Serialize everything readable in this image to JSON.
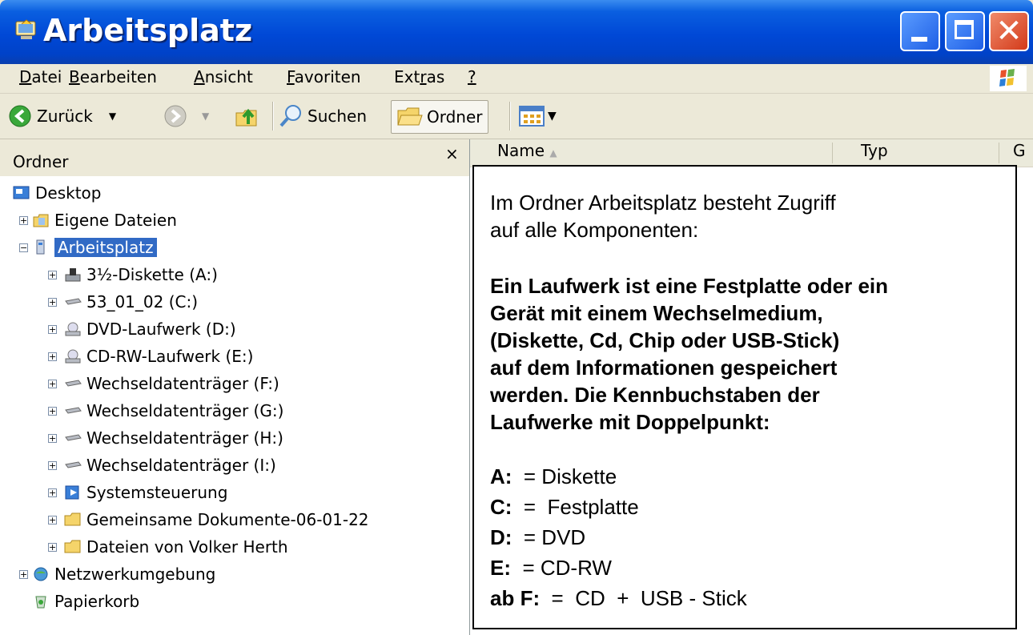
{
  "window": {
    "title": "Arbeitsplatz"
  },
  "menu": [
    {
      "pre": "",
      "ul": "D",
      "post": "atei"
    },
    {
      "pre": "",
      "ul": "B",
      "post": "earbeiten"
    },
    {
      "pre": "",
      "ul": "A",
      "post": "nsicht"
    },
    {
      "pre": "",
      "ul": "F",
      "post": "avoriten"
    },
    {
      "pre": "Ext",
      "ul": "r",
      "post": "as"
    },
    {
      "pre": "",
      "ul": "?",
      "post": ""
    }
  ],
  "toolbar": {
    "back_label": "Zurück",
    "search_label": "Suchen",
    "folders_label": "Ordner"
  },
  "folder_pane": {
    "title": "Ordner",
    "close": "×"
  },
  "tree": [
    {
      "label": "Desktop",
      "icon": "desktop-icon"
    },
    {
      "label": "Eigene Dateien",
      "icon": "my-documents-icon"
    },
    {
      "label": "Arbeitsplatz",
      "icon": "my-computer-icon",
      "selected": true
    },
    {
      "label": "3½-Diskette (A:)",
      "icon": "floppy-drive-icon"
    },
    {
      "label": "53_01_02 (C:)",
      "icon": "hard-drive-icon"
    },
    {
      "label": "DVD-Laufwerk (D:)",
      "icon": "dvd-drive-icon"
    },
    {
      "label": "CD-RW-Laufwerk (E:)",
      "icon": "cd-drive-icon"
    },
    {
      "label": "Wechseldatenträger (F:)",
      "icon": "removable-drive-icon"
    },
    {
      "label": "Wechseldatenträger (G:)",
      "icon": "removable-drive-icon"
    },
    {
      "label": "Wechseldatenträger (H:)",
      "icon": "removable-drive-icon"
    },
    {
      "label": "Wechseldatenträger (I:)",
      "icon": "removable-drive-icon"
    },
    {
      "label": "Systemsteuerung",
      "icon": "control-panel-icon"
    },
    {
      "label": "Gemeinsame Dokumente-06-01-22",
      "icon": "folder-icon"
    },
    {
      "label": "Dateien von Volker Herth",
      "icon": "folder-icon"
    },
    {
      "label": "Netzwerkumgebung",
      "icon": "network-icon"
    },
    {
      "label": "Papierkorb",
      "icon": "recycle-bin-icon"
    }
  ],
  "columns": {
    "name": "Name",
    "type": "Typ",
    "g": "G"
  },
  "info": {
    "intro1": "Im Ordner Arbeitsplatz besteht Zugriff",
    "intro2": "auf alle Komponenten:",
    "b1": "Ein Laufwerk ist eine Festplatte oder ein",
    "b2": "Gerät mit einem Wechselmedium,",
    "b3": "(Diskette, Cd, Chip oder USB-Stick)",
    "b4": "auf dem Informationen gespeichert",
    "b5": "werden.  Die Kennbuchstaben der",
    "b6": "Laufwerke mit Doppelpunkt:",
    "items": [
      {
        "key": "A:",
        "value": "  = Diskette"
      },
      {
        "key": "C:",
        "value": "  =  Festplatte"
      },
      {
        "key": "D:",
        "value": "  = DVD"
      },
      {
        "key": "E:",
        "value": "  = CD-RW"
      },
      {
        "key": "ab F:",
        "value": "  =  CD  +  USB - Stick"
      }
    ]
  }
}
